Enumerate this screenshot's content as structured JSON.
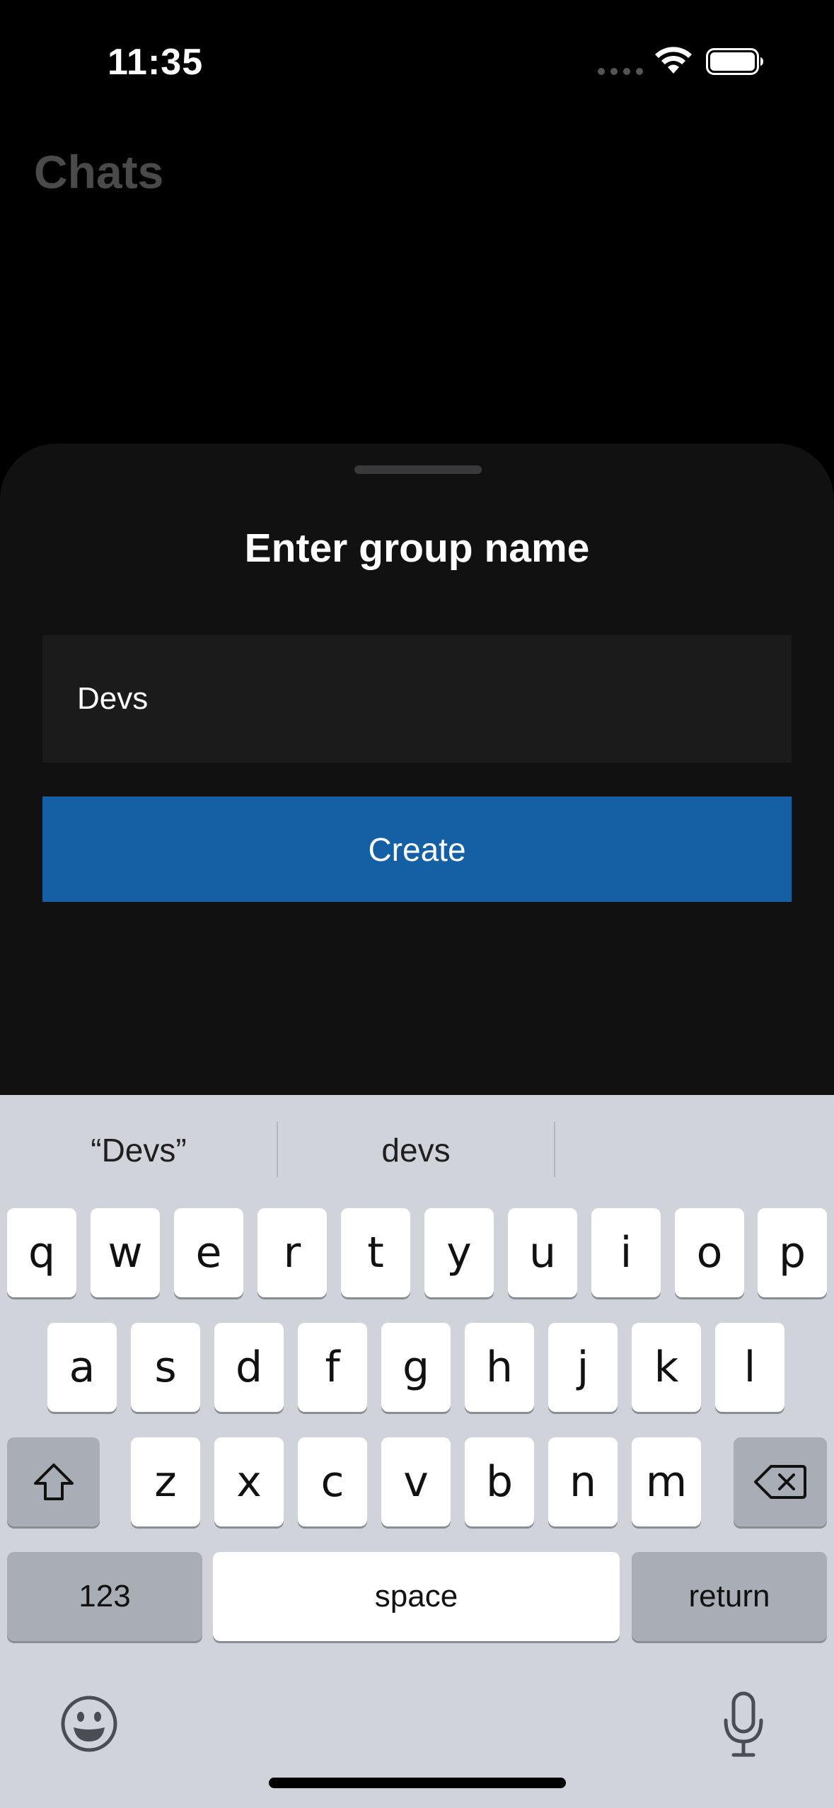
{
  "status_bar": {
    "time": "11:35"
  },
  "background": {
    "title": "Chats"
  },
  "sheet": {
    "title": "Enter group name",
    "input_value": "Devs",
    "create_label": "Create"
  },
  "keyboard": {
    "suggestions": [
      "“Devs”",
      "devs",
      ""
    ],
    "row1": [
      "q",
      "w",
      "e",
      "r",
      "t",
      "y",
      "u",
      "i",
      "o",
      "p"
    ],
    "row2": [
      "a",
      "s",
      "d",
      "f",
      "g",
      "h",
      "j",
      "k",
      "l"
    ],
    "row3": [
      "z",
      "x",
      "c",
      "v",
      "b",
      "n",
      "m"
    ],
    "numbers_label": "123",
    "space_label": "space",
    "return_label": "return"
  },
  "colors": {
    "accent": "#1560a4",
    "sheet_bg": "#111111",
    "keyboard_bg": "#d0d3d9"
  }
}
